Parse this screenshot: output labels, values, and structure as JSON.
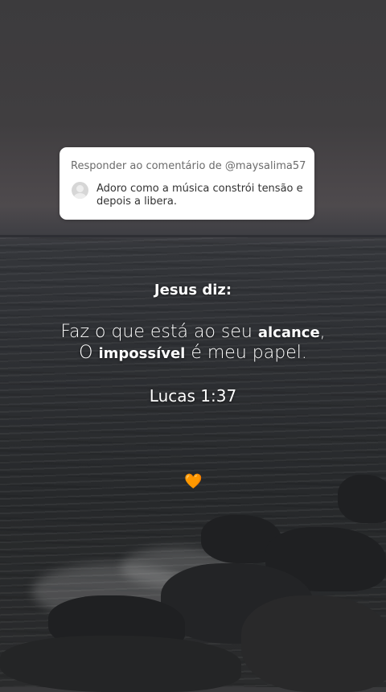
{
  "comment": {
    "header": "Responder ao comentário de @maysalima57",
    "text": "Adoro como a música constrói tensão e depois a  libera."
  },
  "overlay": {
    "title": "Jesus diz:",
    "line1_part1": "Faz o que está ao seu ",
    "line1_bold": "alcance",
    "line1_part2": ",",
    "line2_part1": "O ",
    "line2_bold": "impossível",
    "line2_part2": " é meu papel.",
    "reference": "Lucas 1:37",
    "emoji": "🧡"
  },
  "colors": {
    "card": "#ffffff",
    "heart": "#f39a3c"
  }
}
